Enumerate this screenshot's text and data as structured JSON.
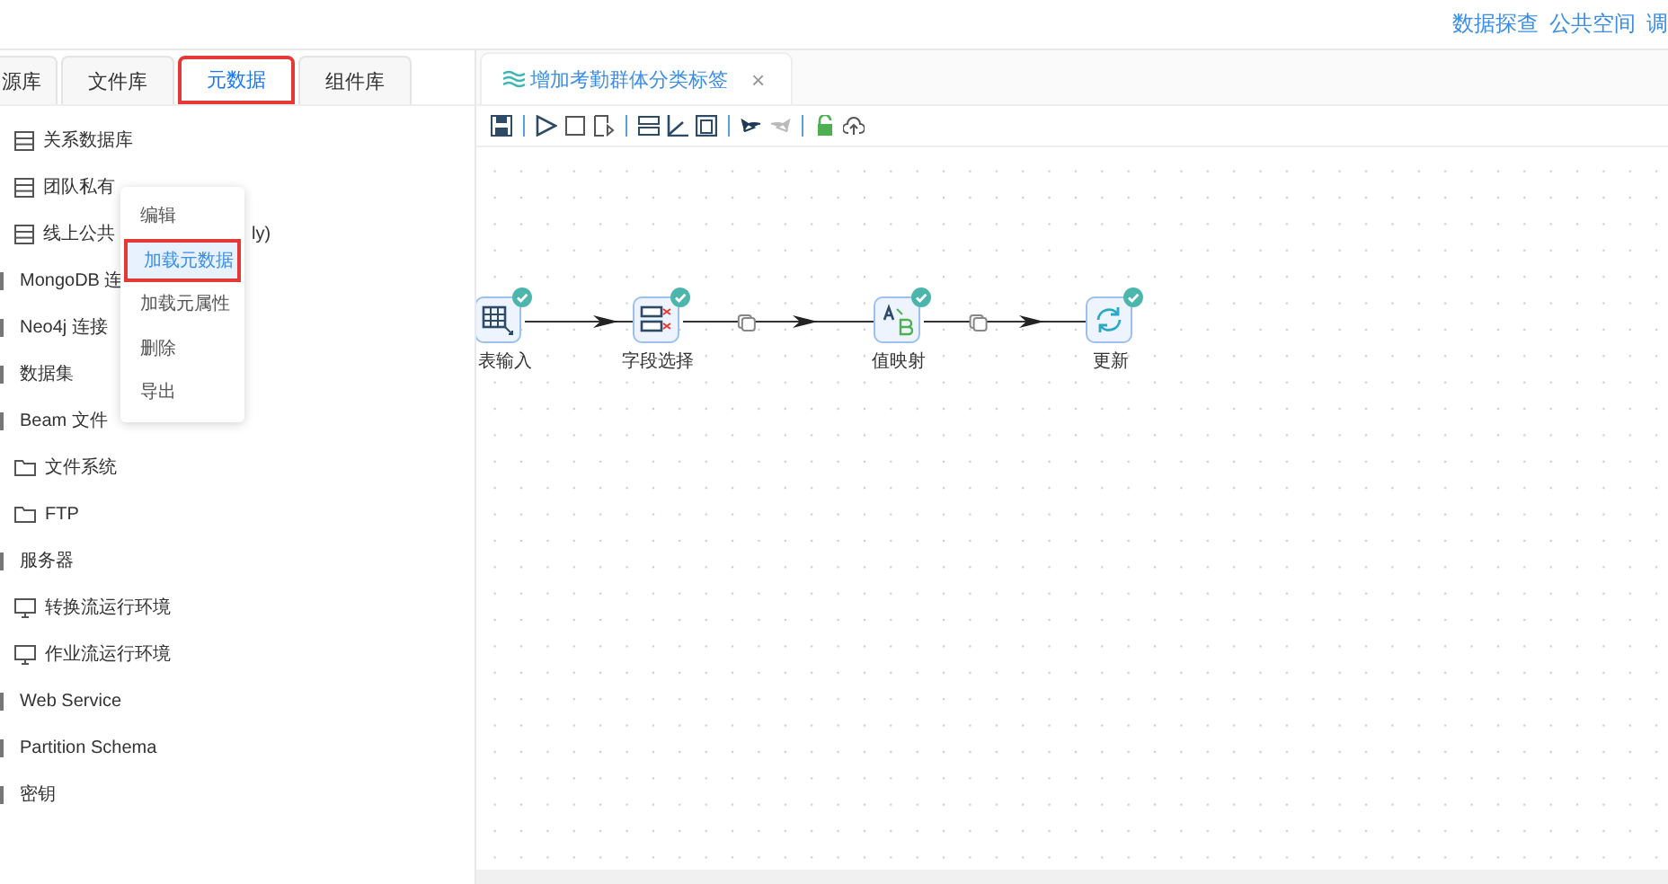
{
  "top_links": [
    "数据探查",
    "公共空间",
    "调"
  ],
  "panel_tabs": [
    {
      "label": "源库",
      "selected": false
    },
    {
      "label": "文件库",
      "selected": false
    },
    {
      "label": "元数据",
      "selected": true
    },
    {
      "label": "组件库",
      "selected": false
    }
  ],
  "tree": [
    {
      "children": [
        {
          "label": "关系数据库",
          "kind": "table"
        },
        {
          "label": "团队私有",
          "kind": "table"
        },
        {
          "label": "线上公共",
          "kind": "table",
          "tail": "ly)"
        }
      ]
    },
    {
      "label": "MongoDB 连",
      "kind": "node"
    },
    {
      "label": "Neo4j 连接",
      "kind": "node"
    },
    {
      "label": "数据集",
      "kind": "node"
    },
    {
      "label": "Beam 文件",
      "kind": "node",
      "children": [
        {
          "label": "文件系统",
          "kind": "folder"
        },
        {
          "label": "FTP",
          "kind": "folder"
        }
      ]
    },
    {
      "label": "服务器",
      "kind": "node",
      "children": [
        {
          "label": "转换流运行环境",
          "kind": "monitor"
        },
        {
          "label": "作业流运行环境",
          "kind": "monitor"
        }
      ]
    },
    {
      "label": "Web Service",
      "kind": "node"
    },
    {
      "label": "Partition Schema",
      "kind": "node"
    },
    {
      "label": "密钥",
      "kind": "node"
    }
  ],
  "context_menu": [
    {
      "label": "编辑",
      "selected": false
    },
    {
      "label": "加载元数据",
      "selected": true
    },
    {
      "label": "加载元属性",
      "selected": false
    },
    {
      "label": "删除",
      "selected": false
    },
    {
      "label": "导出",
      "selected": false
    }
  ],
  "editor_tab": {
    "title": "增加考勤群体分类标签",
    "close": "×"
  },
  "flow": {
    "nodes": [
      {
        "label": "表输入",
        "kind": "table-input",
        "done": true
      },
      {
        "label": "字段选择",
        "kind": "select-fields",
        "done": true
      },
      {
        "label": "值映射",
        "kind": "value-map",
        "done": true
      },
      {
        "label": "更新",
        "kind": "update",
        "done": true
      }
    ],
    "links": [
      {
        "copy": false
      },
      {
        "copy": true
      },
      {
        "copy": true
      }
    ]
  }
}
